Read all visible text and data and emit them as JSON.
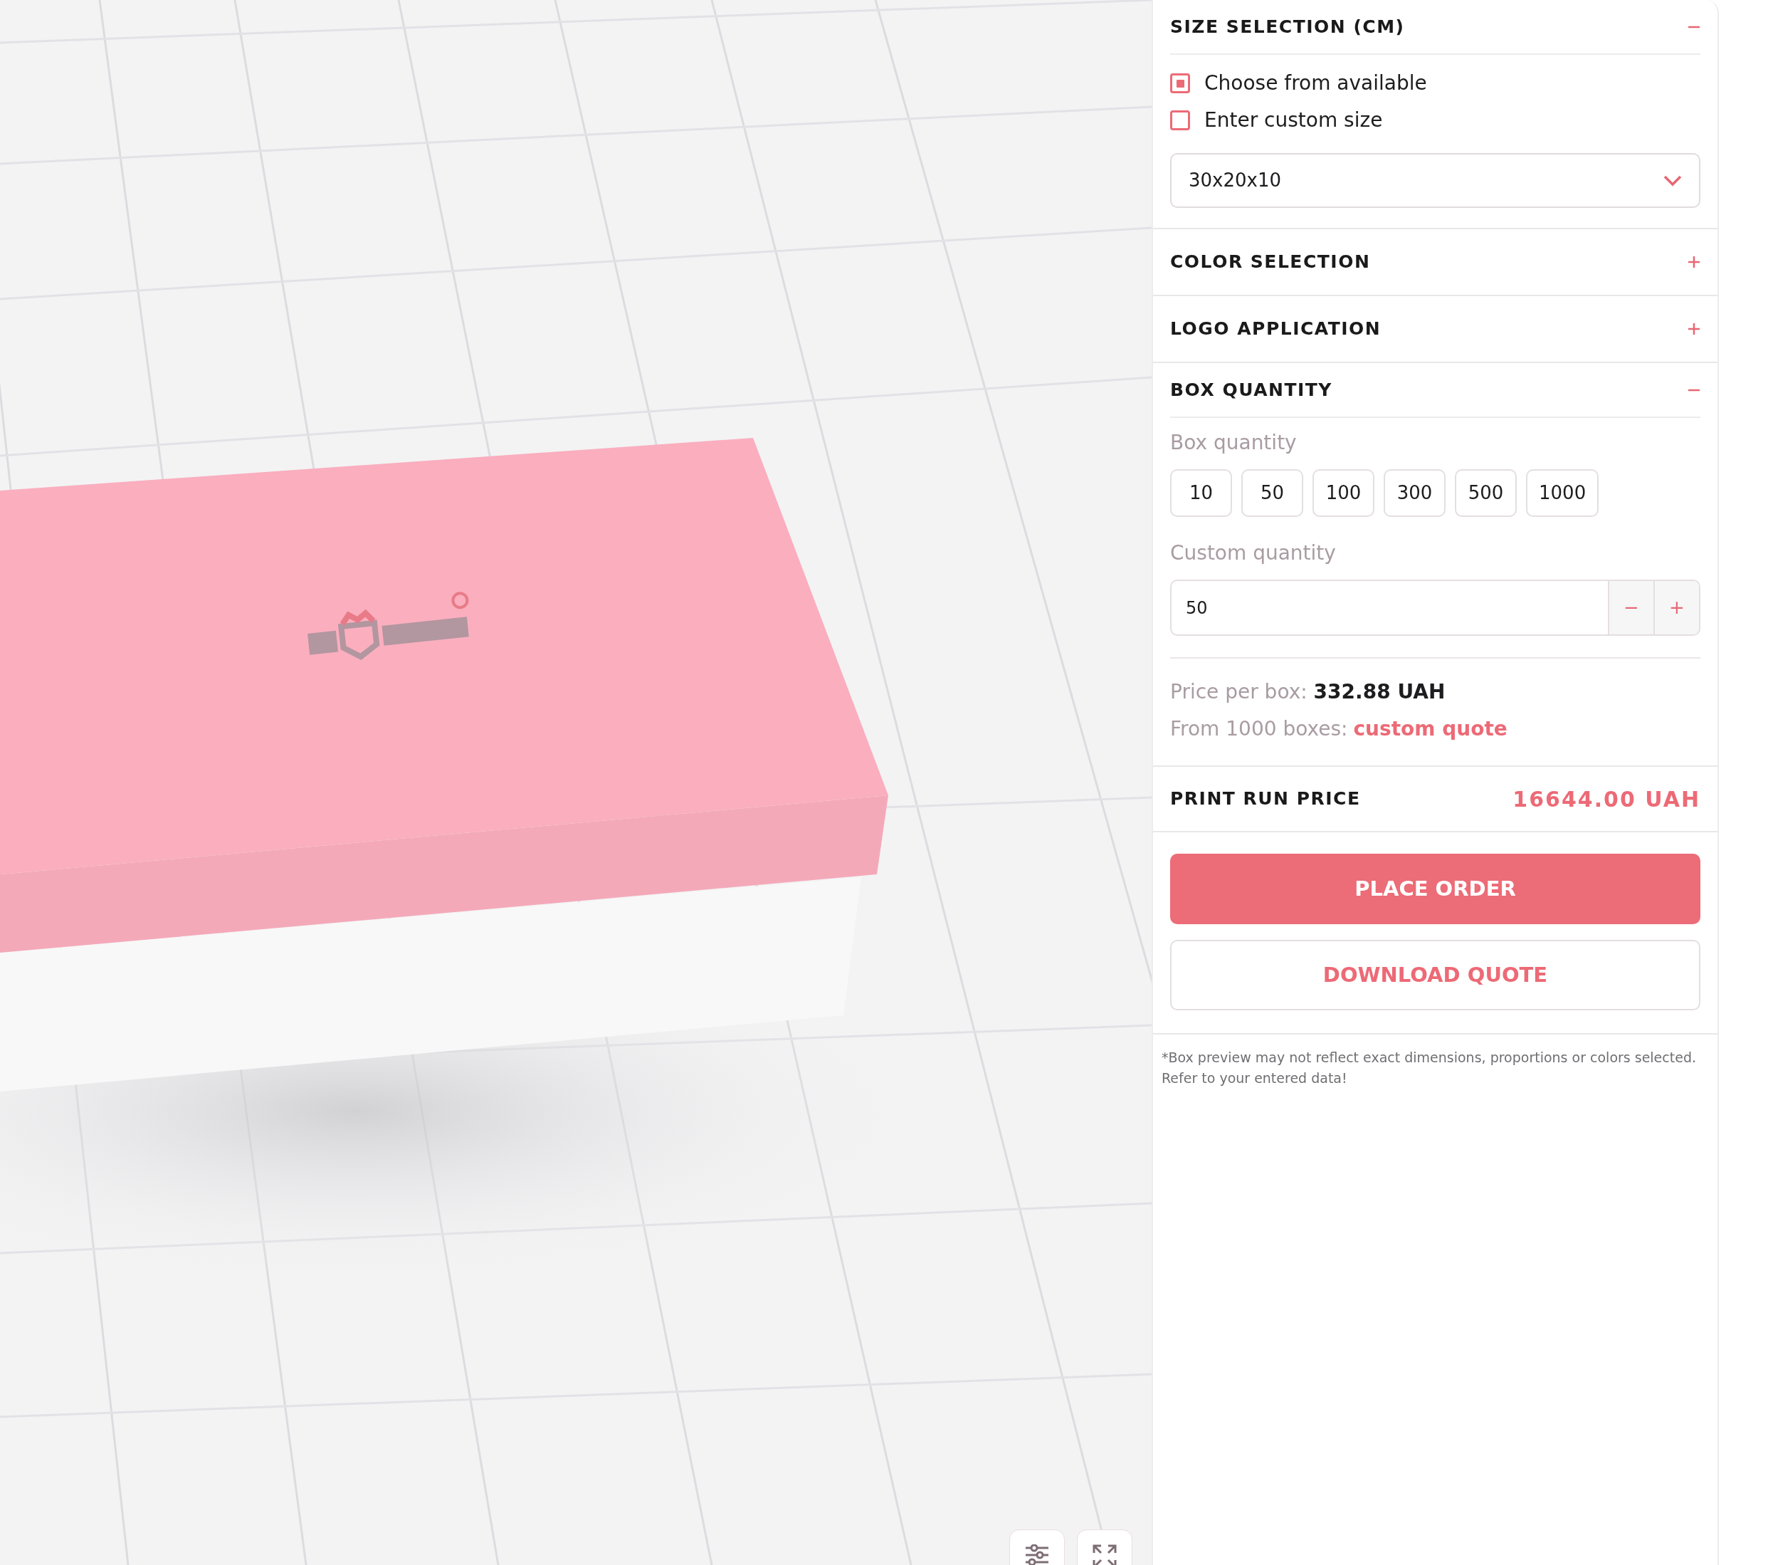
{
  "sections": [
    {
      "title": "SIZE SELECTION (CM)",
      "expanded": true,
      "kind": "size"
    },
    {
      "title": "COLOR SELECTION",
      "expanded": false
    },
    {
      "title": "LOGO APPLICATION",
      "expanded": false
    },
    {
      "title": "BOX QUANTITY",
      "expanded": true,
      "kind": "quantity"
    }
  ],
  "size": {
    "options": [
      {
        "label": "Choose from available",
        "checked": true
      },
      {
        "label": "Enter custom size",
        "checked": false
      }
    ],
    "dropdown_value": "30x20x10"
  },
  "quantity": {
    "label": "Box quantity",
    "presets": [
      "10",
      "50",
      "100",
      "300",
      "500",
      "1000"
    ],
    "custom_label": "Custom quantity",
    "custom_value": "50",
    "decrement": "−",
    "increment": "+",
    "price_label": "Price per box:",
    "price_value": "332.88 UAH",
    "quote_label": "From 1000 boxes:",
    "quote_link": "custom quote"
  },
  "print_run": {
    "label": "PRINT RUN PRICE",
    "value": "16644.00 UAH"
  },
  "buttons": {
    "primary": "PLACE ORDER",
    "secondary": "DOWNLOAD QUOTE"
  },
  "footnote": "*Box preview may not reflect exact dimensions, proportions or colors selected. Refer to your entered data!"
}
